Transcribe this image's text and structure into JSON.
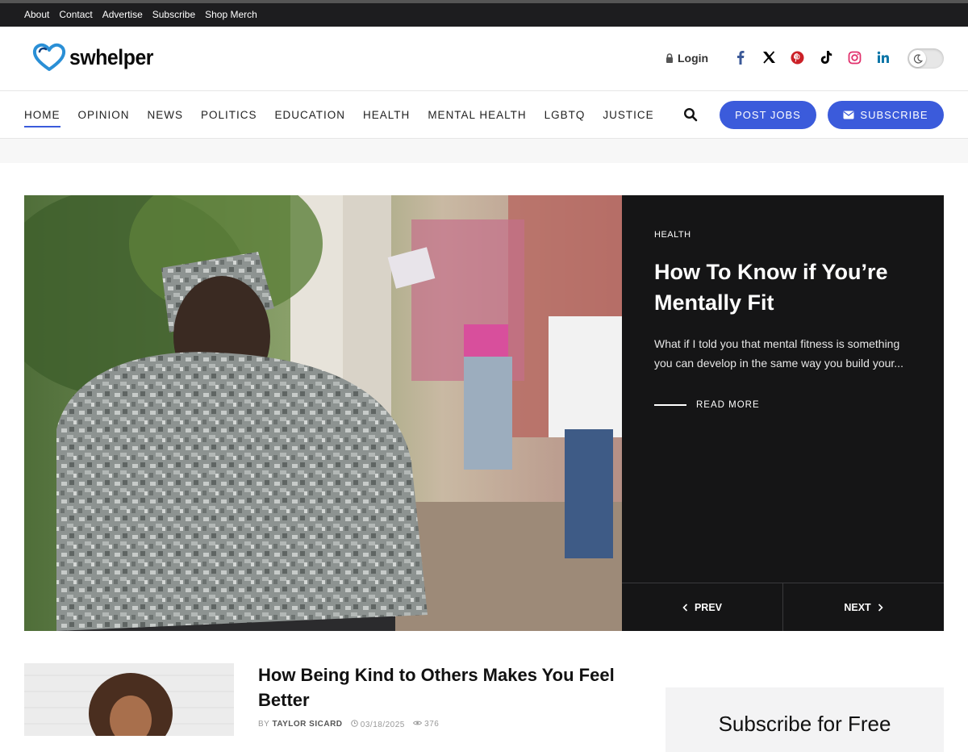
{
  "topbar": {
    "links": [
      "About",
      "Contact",
      "Advertise",
      "Subscribe",
      "Shop Merch"
    ]
  },
  "header": {
    "logo_text": "swhelper",
    "login_label": "Login",
    "socials": [
      "facebook-icon",
      "x-icon",
      "pinterest-icon",
      "tiktok-icon",
      "instagram-icon",
      "linkedin-icon"
    ],
    "social_colors": {
      "facebook": "#3b5998",
      "x": "#000000",
      "pinterest": "#cb2027",
      "tiktok": "#000000",
      "instagram": "#e1306c",
      "linkedin": "#0e76a8"
    }
  },
  "nav": {
    "items": [
      "HOME",
      "OPINION",
      "NEWS",
      "POLITICS",
      "EDUCATION",
      "HEALTH",
      "MENTAL HEALTH",
      "LGBTQ",
      "JUSTICE"
    ],
    "active": "HOME",
    "post_jobs_label": "POST JOBS",
    "subscribe_label": "SUBSCRIBE",
    "accent": "#3b5bdb"
  },
  "hero": {
    "category": "HEALTH",
    "title": "How To Know if You’re Mentally Fit",
    "excerpt": "What if I told you that mental fitness is something you can develop in the same way you build your...",
    "read_more": "READ MORE",
    "prev_label": "PREV",
    "next_label": "NEXT"
  },
  "article": {
    "title": "How Being Kind to Others Makes You Feel Better",
    "author_prefix": "BY",
    "author": "TAYLOR SICARD",
    "date": "03/18/2025",
    "views": "376"
  },
  "sidebar": {
    "title": "Subscribe for Free"
  }
}
